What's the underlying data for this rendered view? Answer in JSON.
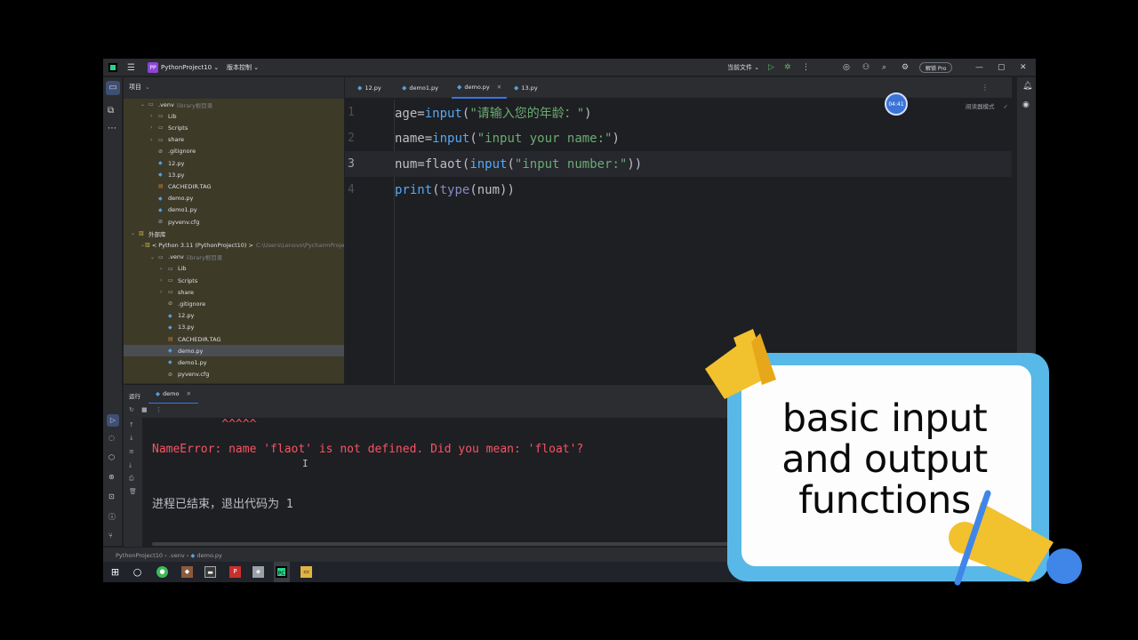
{
  "titlebar": {
    "project_badge": "PP",
    "project_name": "PythonProject10 ⌄",
    "vcs": "版本控制 ⌄",
    "run_config": "当前文件 ⌄",
    "pro_button": "解锁 Pro",
    "win_min": "—",
    "win_max": "▢",
    "win_close": "✕"
  },
  "project_panel": {
    "title": "项目",
    "chevron": "⌄",
    "tree": [
      {
        "indent": 1,
        "chev": "⌄",
        "icon": "folder",
        "name": ".venv",
        "hint": "library根目录"
      },
      {
        "indent": 2,
        "chev": "›",
        "icon": "folder",
        "name": "Lib",
        "hint": ""
      },
      {
        "indent": 2,
        "chev": "›",
        "icon": "folder",
        "name": "Scripts",
        "hint": ""
      },
      {
        "indent": 2,
        "chev": "›",
        "icon": "folder",
        "name": "share",
        "hint": ""
      },
      {
        "indent": 2,
        "chev": "",
        "icon": "cfg",
        "name": ".gitignore",
        "hint": ""
      },
      {
        "indent": 2,
        "chev": "",
        "icon": "py",
        "name": "12.py",
        "hint": ""
      },
      {
        "indent": 2,
        "chev": "",
        "icon": "py",
        "name": "13.py",
        "hint": ""
      },
      {
        "indent": 2,
        "chev": "",
        "icon": "tag",
        "name": "CACHEDIR.TAG",
        "hint": ""
      },
      {
        "indent": 2,
        "chev": "",
        "icon": "py",
        "name": "demo.py",
        "hint": ""
      },
      {
        "indent": 2,
        "chev": "",
        "icon": "py",
        "name": "demo1.py",
        "hint": ""
      },
      {
        "indent": 2,
        "chev": "",
        "icon": "cfg",
        "name": "pyvenv.cfg",
        "hint": ""
      },
      {
        "indent": 0,
        "chev": "⌄",
        "icon": "lib",
        "name": "外部库",
        "hint": ""
      },
      {
        "indent": 1,
        "chev": "⌄",
        "icon": "lib",
        "name": "< Python 3.11 (PythonProject10) >",
        "hint": "C:\\Users\\Lenovo\\PycharmProje"
      },
      {
        "indent": 2,
        "chev": "⌄",
        "icon": "folder",
        "name": ".venv",
        "hint": "library根目录"
      },
      {
        "indent": 3,
        "chev": "›",
        "icon": "folder",
        "name": "Lib",
        "hint": ""
      },
      {
        "indent": 3,
        "chev": "›",
        "icon": "folder",
        "name": "Scripts",
        "hint": ""
      },
      {
        "indent": 3,
        "chev": "›",
        "icon": "folder",
        "name": "share",
        "hint": ""
      },
      {
        "indent": 3,
        "chev": "",
        "icon": "cfg",
        "name": ".gitignore",
        "hint": ""
      },
      {
        "indent": 3,
        "chev": "",
        "icon": "py",
        "name": "12.py",
        "hint": ""
      },
      {
        "indent": 3,
        "chev": "",
        "icon": "py",
        "name": "13.py",
        "hint": ""
      },
      {
        "indent": 3,
        "chev": "",
        "icon": "tag",
        "name": "CACHEDIR.TAG",
        "hint": ""
      },
      {
        "indent": 3,
        "chev": "",
        "icon": "py",
        "name": "demo.py",
        "hint": "",
        "selected": true
      },
      {
        "indent": 3,
        "chev": "",
        "icon": "py",
        "name": "demo1.py",
        "hint": ""
      },
      {
        "indent": 3,
        "chev": "",
        "icon": "cfg",
        "name": "pyvenv.cfg",
        "hint": ""
      }
    ]
  },
  "editor": {
    "tabs": [
      {
        "name": "12.py",
        "active": false
      },
      {
        "name": "demo1.py",
        "active": false
      },
      {
        "name": "demo.py",
        "active": true
      },
      {
        "name": "13.py",
        "active": false
      }
    ],
    "lines": [
      {
        "number": "1",
        "code": "age=input(\"请输入您的年龄：\")"
      },
      {
        "number": "2",
        "code": "name=input(\"input your name:\")"
      },
      {
        "number": "3",
        "code": "num=flaot(input(\"input number:\"))"
      },
      {
        "number": "4",
        "code": "print(type(num))"
      }
    ],
    "current_line": 3,
    "timer": "04:41",
    "reader_mode": "阅读器模式"
  },
  "run_panel": {
    "label": "运行",
    "tab": "demo",
    "console": {
      "carets": "          ^^^^^",
      "error": "NameError: name 'flaot' is not defined. Did you mean: 'float'?",
      "exit": "进程已结束，退出代码为 1"
    }
  },
  "statusbar": {
    "crumbs": [
      "PythonProject10",
      ".venv",
      "demo.py"
    ],
    "sep": " › "
  },
  "overlay": {
    "lines": [
      "basic input",
      "and  output",
      "functions"
    ],
    "colors": {
      "blue": "#58b9e8",
      "yellow": "#f2c12e",
      "accent_blue": "#3f86e8"
    }
  }
}
